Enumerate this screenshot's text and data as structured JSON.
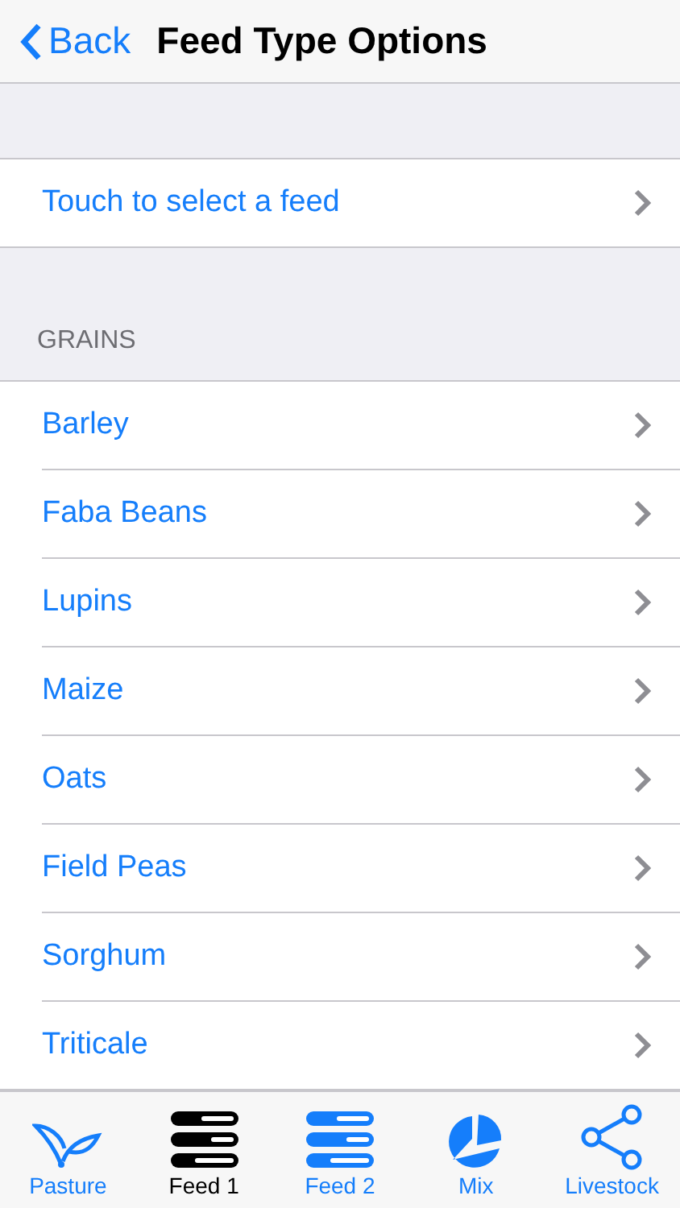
{
  "nav_bar": {
    "back": "Back",
    "title": "Feed Type Options"
  },
  "select_row": {
    "label": "Touch to select a feed"
  },
  "section": {
    "header": "GRAINS",
    "items": [
      {
        "label": "Barley"
      },
      {
        "label": "Faba Beans"
      },
      {
        "label": "Lupins"
      },
      {
        "label": "Maize"
      },
      {
        "label": "Oats"
      },
      {
        "label": "Field Peas"
      },
      {
        "label": "Sorghum"
      },
      {
        "label": "Triticale"
      }
    ]
  },
  "tab_bar": [
    {
      "label": "Pasture",
      "kind": "leaf",
      "selected": false
    },
    {
      "label": "Feed 1",
      "kind": "bars",
      "selected": true
    },
    {
      "label": "Feed 2",
      "kind": "bars",
      "selected": false
    },
    {
      "label": "Mix",
      "kind": "pie",
      "selected": false
    },
    {
      "label": "Livestock",
      "kind": "share",
      "selected": false
    }
  ]
}
